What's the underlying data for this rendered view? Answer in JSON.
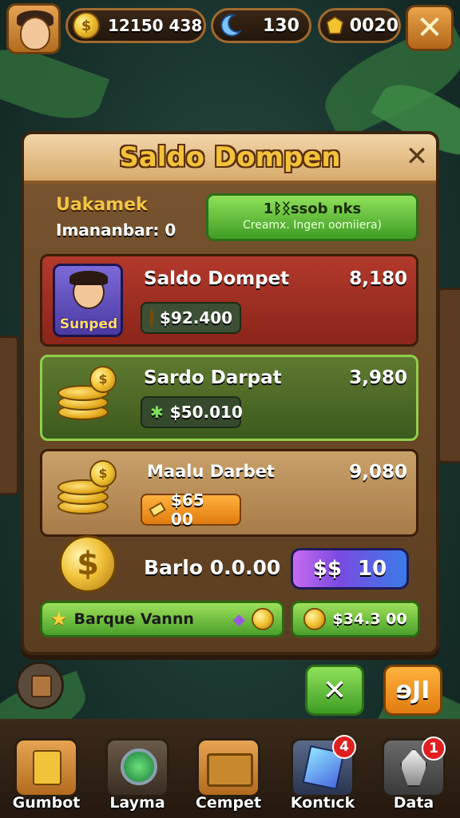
{
  "topbar": {
    "coins": "12150  438",
    "moon": "130",
    "gems": "0020",
    "close_symbol": "✕",
    "coin_symbol": "$"
  },
  "panel": {
    "title": "Saldo Dompen",
    "close_symbol": "✕",
    "subtitle": "Uakamek",
    "subline": "Imananbar: 0",
    "green_button": {
      "line1": "1ᛒᛝssob nks",
      "line2": "Creamx. Ingen oomiiera)"
    }
  },
  "rows": [
    {
      "name": "Saldo Dompet",
      "amount": "8,180",
      "chip": "$92.400",
      "portrait_label": "Sunped"
    },
    {
      "name": "Sardo Darpat",
      "amount": "3,980",
      "chip": "$50.010"
    },
    {
      "name": "Maalu Darbet",
      "amount": "9,080",
      "chip": "$65 00"
    }
  ],
  "balance": {
    "label": "Barlo 0.0.00",
    "gem_button": {
      "symbol": "$$",
      "value": "10"
    },
    "bar_left": "Barque Vannn",
    "bar_right": "$34.3 00"
  },
  "actions": {
    "confirm_symbol": "✕",
    "orange_label": "ɘJI"
  },
  "nav": [
    {
      "label": "Gumbot"
    },
    {
      "label": "Layma"
    },
    {
      "label": "Cempet"
    },
    {
      "label": "Kontıck",
      "badge": "4"
    },
    {
      "label": "Data",
      "badge": "1"
    }
  ]
}
